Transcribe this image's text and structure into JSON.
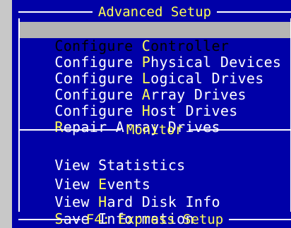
{
  "headers": {
    "advanced": "Advanced Setup",
    "monitor": "Monitor",
    "footer": "F4: Express Setup"
  },
  "menu": {
    "configure_controller": {
      "pre": "Configure ",
      "hot": "C",
      "post": "ontroller"
    },
    "configure_physical": {
      "pre": "Configure ",
      "hot": "P",
      "post": "hysical Devices"
    },
    "configure_logical": {
      "pre": "Configure ",
      "hot": "L",
      "post": "ogical Drives"
    },
    "configure_array": {
      "pre": "Configure ",
      "hot": "A",
      "post": "rray Drives"
    },
    "configure_host": {
      "pre": "Configure ",
      "hot": "H",
      "post": "ost Drives"
    },
    "repair_array": {
      "pre": "",
      "hot": "R",
      "post": "epair Array Drives"
    },
    "view_statistics": {
      "pre": "View ",
      "hot": "",
      "post": "Statistics"
    },
    "view_events": {
      "pre": "View ",
      "hot": "E",
      "post": "vents"
    },
    "view_hdd_info": {
      "pre": "View ",
      "hot": "H",
      "post": "ard Disk Info"
    },
    "save_information": {
      "pre": "",
      "hot": "S",
      "post": "ave Information"
    }
  },
  "selected_item": "Configure Controller",
  "colors": {
    "background": "#0000a8",
    "text": "#ffffff",
    "hotkey": "#ffff55",
    "highlight": "#b4b4b4"
  }
}
